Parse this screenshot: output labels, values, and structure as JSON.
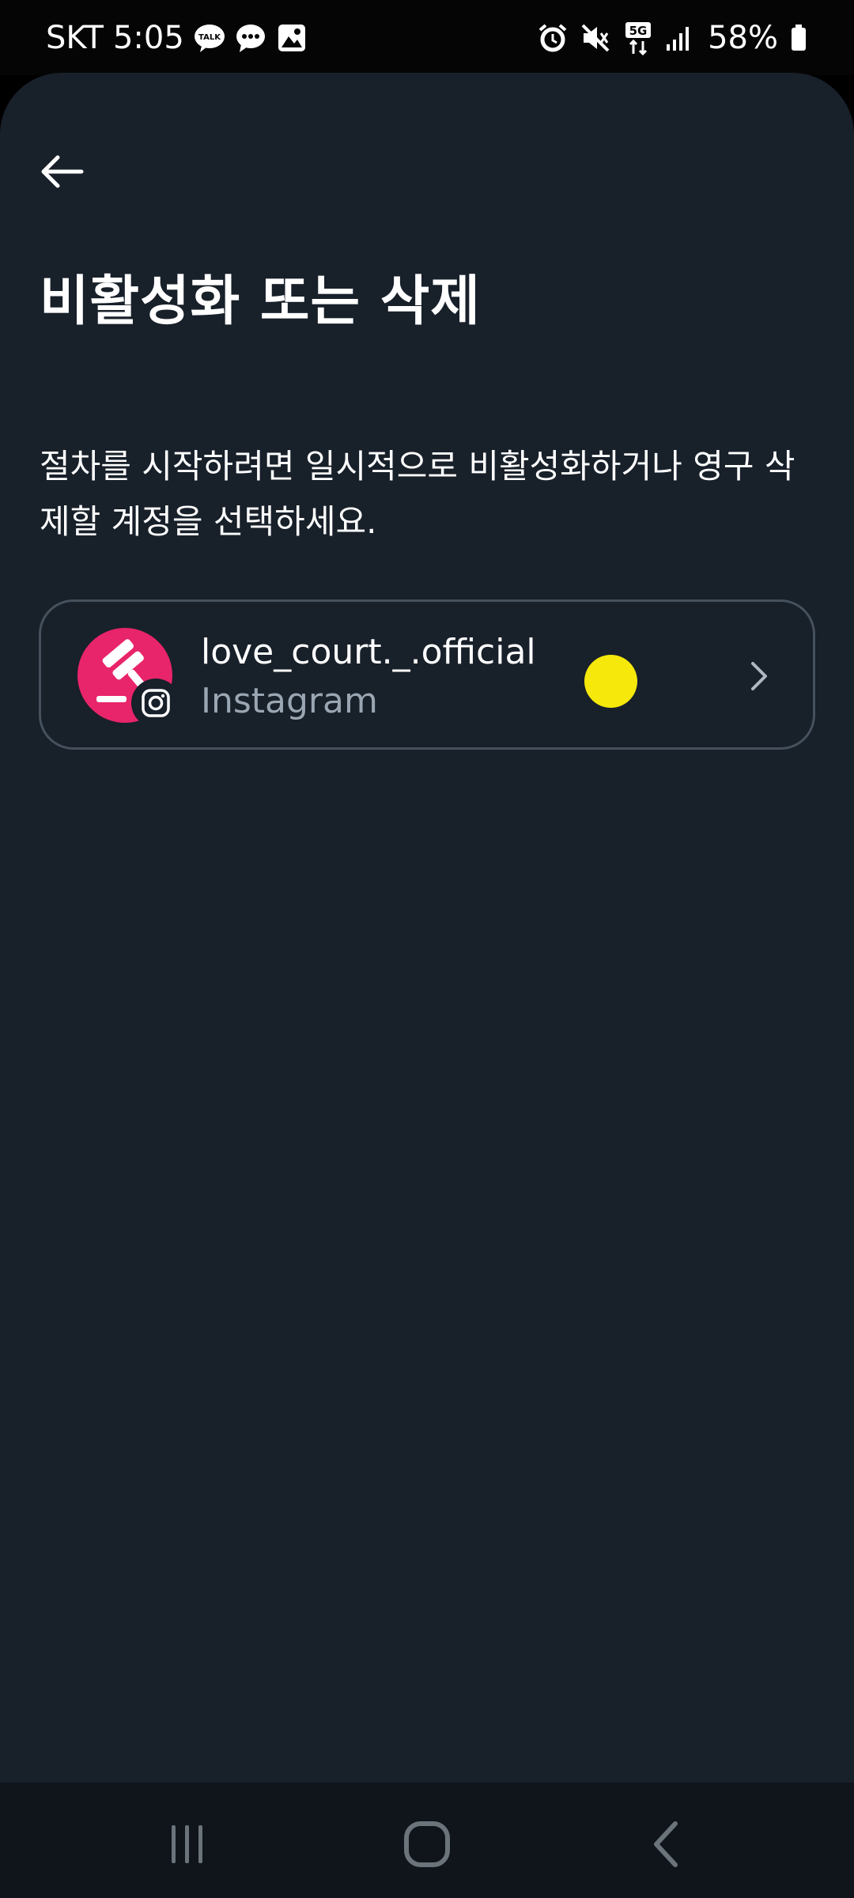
{
  "status_bar": {
    "carrier": "SKT",
    "time": "5:05",
    "talk_icon_text": "TALK",
    "network": "5G",
    "battery": "58%",
    "icons": [
      "kakaotalk-icon",
      "message-icon",
      "gallery-icon",
      "alarm-icon",
      "mute-icon",
      "5g-icon",
      "signal-icon",
      "battery-icon"
    ]
  },
  "header": {
    "back_icon": "back-arrow-icon",
    "title": "비활성화 또는 삭제"
  },
  "main": {
    "description": "절차를 시작하려면 일시적으로 비활성화하거나 영구 삭제할 계정을 선택하세요.",
    "accounts": [
      {
        "username": "love_court._.official",
        "platform": "Instagram",
        "avatar_color": "#e8246a"
      }
    ]
  },
  "nav_bar": {
    "icons": [
      "recent-apps-icon",
      "home-icon",
      "back-icon"
    ]
  },
  "colors": {
    "background": "#18202a",
    "text": "#ffffff",
    "secondary_text": "#9aa6b2",
    "card_border": "#45515c",
    "touch_indicator": "#f5e80a"
  }
}
